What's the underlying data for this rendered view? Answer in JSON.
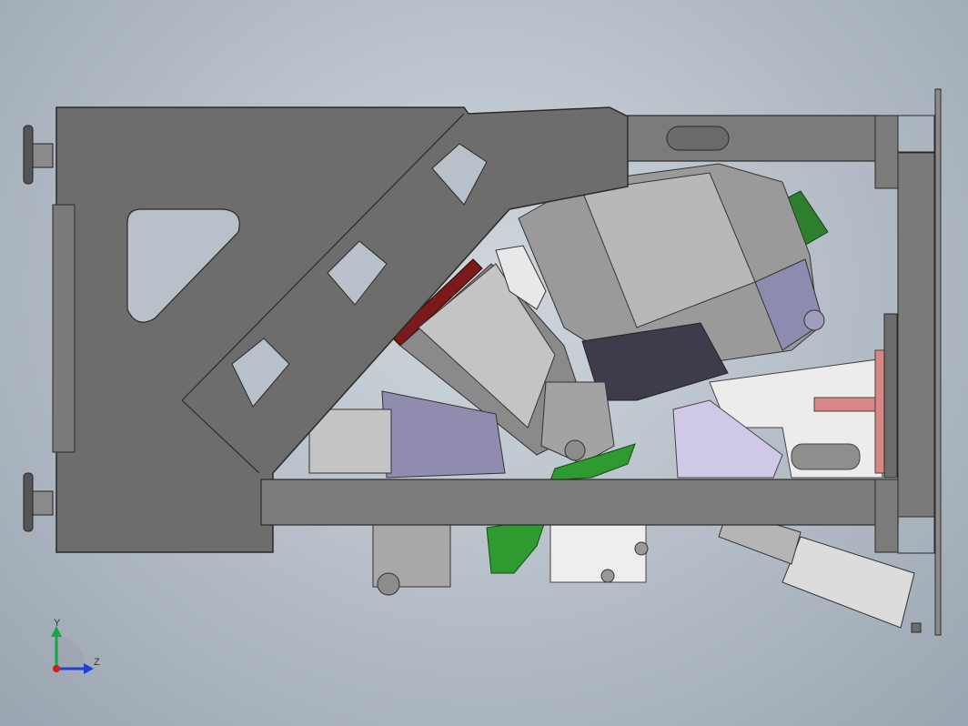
{
  "viewport": {
    "background_top": "#cfd6dd",
    "background_bottom": "#9aa5b1"
  },
  "triad": {
    "y_label": "Y",
    "z_label": "Z",
    "y_color": "#19a34a",
    "z_color": "#1f3fd6",
    "x_color": "#d11f1f"
  },
  "colors": {
    "frame_gray": "#6d6d6d",
    "frame_dark": "#4e4e4e",
    "part_light": "#b9b9b9",
    "part_mid": "#8d8d8d",
    "lavender": "#9b98b8",
    "green": "#2f8a2f",
    "bright_green": "#28b028",
    "maroon": "#7a1a1a",
    "pink": "#d88080",
    "white_part": "#eeeeee"
  }
}
